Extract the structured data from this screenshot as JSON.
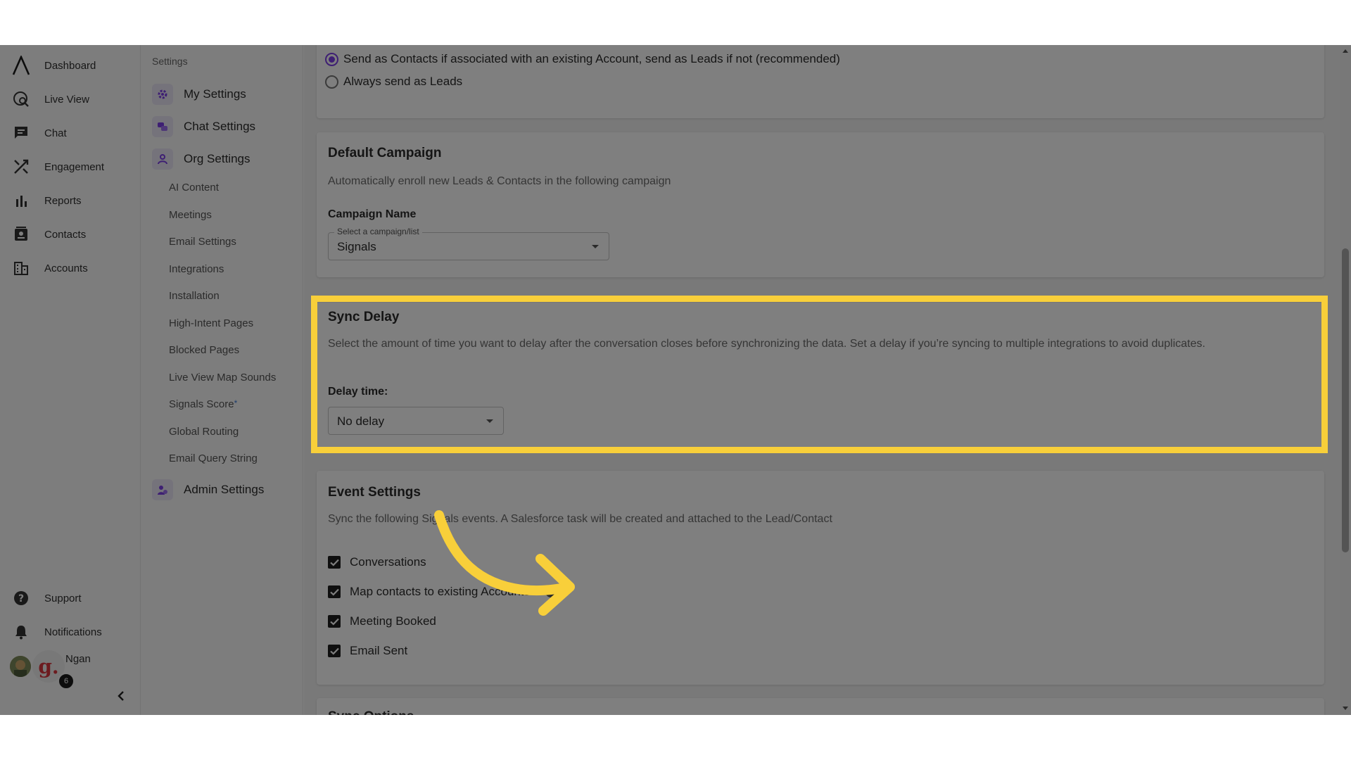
{
  "nav": {
    "items": [
      {
        "label": "Dashboard",
        "icon": "logo-icon"
      },
      {
        "label": "Live View",
        "icon": "live-view-icon"
      },
      {
        "label": "Chat",
        "icon": "chat-icon"
      },
      {
        "label": "Engagement",
        "icon": "engagement-icon"
      },
      {
        "label": "Reports",
        "icon": "bar-chart-icon"
      },
      {
        "label": "Contacts",
        "icon": "contacts-icon"
      },
      {
        "label": "Accounts",
        "icon": "building-icon"
      }
    ],
    "support": "Support",
    "notifications": "Notifications",
    "user": {
      "name": "Ngan",
      "avatar_letter": "g.",
      "badge_count": "6"
    }
  },
  "settings_nav": {
    "header": "Settings",
    "groups": {
      "my": "My Settings",
      "chat": "Chat Settings",
      "org": "Org Settings",
      "admin": "Admin Settings"
    },
    "org_items": [
      "AI Content",
      "Meetings",
      "Email Settings",
      "Integrations",
      "Installation",
      "High-Intent Pages",
      "Blocked Pages",
      "Live View Map Sounds",
      "Signals Score",
      "Global Routing",
      "Email Query String"
    ],
    "signals_score_marker": "*"
  },
  "main": {
    "sync_mode": {
      "option_1": "Send as Contacts if associated with an existing Account, send as Leads if not (recommended)",
      "option_2": "Always send as Leads",
      "selected": "option_1"
    },
    "default_campaign": {
      "title": "Default Campaign",
      "description": "Automatically enroll new Leads & Contacts in the following campaign",
      "field_label": "Campaign Name",
      "select_legend": "Select a campaign/list",
      "select_value": "Signals"
    },
    "sync_delay": {
      "title": "Sync Delay",
      "description": "Select the amount of time you want to delay after the conversation closes before synchronizing the data. Set a delay if you’re syncing to multiple integrations to avoid duplicates.",
      "field_label": "Delay time:",
      "select_value": "No delay"
    },
    "event_settings": {
      "title": "Event Settings",
      "description": "Sync the following Signals events. A Salesforce task will be created and attached to the Lead/Contact",
      "checkboxes": [
        {
          "label": "Conversations",
          "checked": true
        },
        {
          "label": "Map contacts to existing Accounts",
          "checked": true
        },
        {
          "label": "Meeting Booked",
          "checked": true
        },
        {
          "label": "Email Sent",
          "checked": true
        }
      ]
    },
    "next_section_title": "Sync Options"
  },
  "colors": {
    "accent": "#7d3fe6",
    "highlight": "#f8cf3a",
    "overlay": "rgba(0,0,0,0.5)"
  }
}
